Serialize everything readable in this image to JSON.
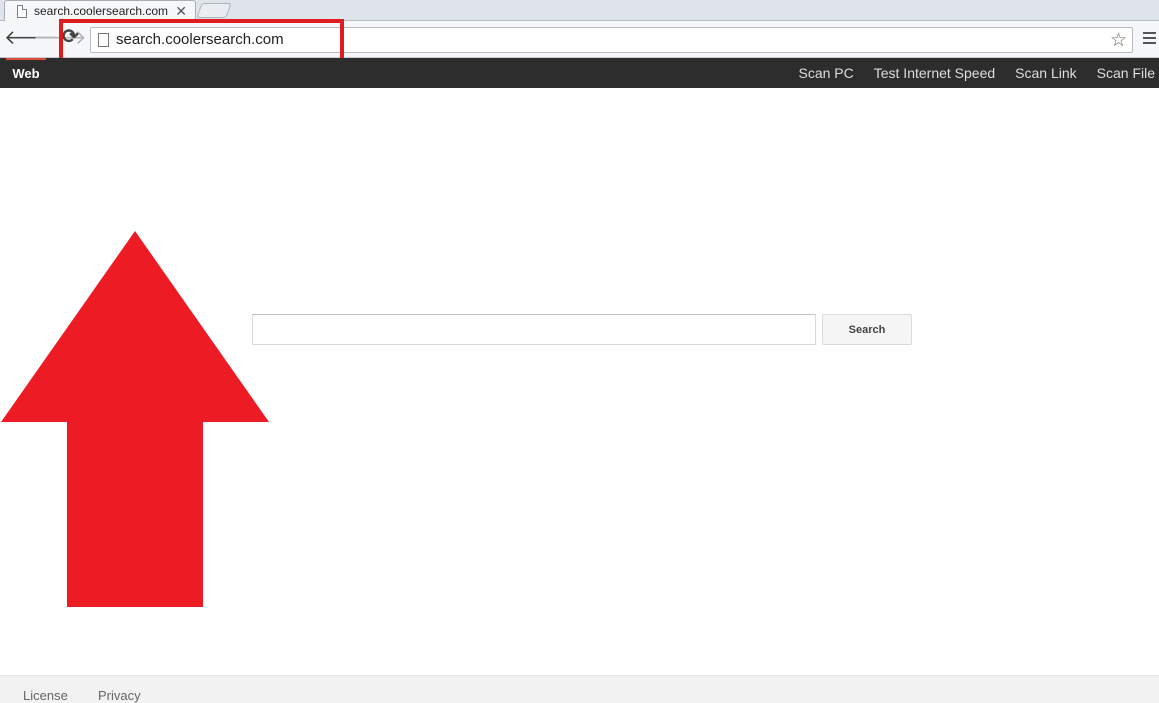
{
  "browser": {
    "tab_title": "search.coolersearch.com",
    "tab_close": "✕",
    "address": "search.coolersearch.com",
    "back_glyph": "🡐",
    "forward_glyph": "🡒",
    "reload_glyph": "⟳",
    "star_glyph": "☆"
  },
  "topbar": {
    "active_tab": "Web",
    "links": [
      "Scan PC",
      "Test Internet Speed",
      "Scan Link",
      "Scan File"
    ]
  },
  "search": {
    "value": "",
    "placeholder": "",
    "button_label": "Search"
  },
  "footer": {
    "license": "License",
    "privacy": "Privacy"
  },
  "colors": {
    "annotation_red": "#e11b22",
    "topbar_bg": "#2d2d2d"
  },
  "icons": [
    "page-icon",
    "close-icon",
    "back-arrow-icon",
    "forward-arrow-icon",
    "reload-icon",
    "star-icon",
    "menu-icon",
    "red-up-arrow"
  ]
}
